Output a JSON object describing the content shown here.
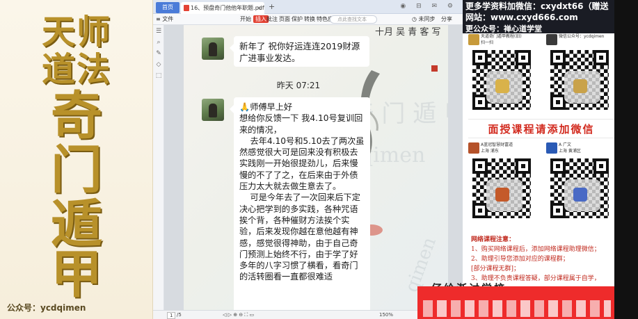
{
  "left_banner": {
    "line1": "天师",
    "line2": "道法",
    "vertical": [
      "奇",
      "门",
      "遁",
      "甲"
    ],
    "footer": "公众号：ycdqimen"
  },
  "app": {
    "tabs": {
      "home": "首页",
      "doc": "16、预盘奇门他他年职题.pdf *",
      "close": "×",
      "plus": "+"
    },
    "title_icons": "◉ ⊟ ✉ ⚙",
    "toolbar": {
      "file": "≡ 文件",
      "items": [
        "开始",
        "插入",
        "批注",
        "页面",
        "保护",
        "转换",
        "特色应用"
      ],
      "active": "插入",
      "search_placeholder": "点此查找文本",
      "sync": "◷ 未同步",
      "share": "分享"
    },
    "sidebar_icons": [
      "☰",
      "⌕",
      "✎",
      "◇",
      "⬚"
    ],
    "chat": {
      "bubble1": "新年了 祝你好运连连2019财源广进事业发达。",
      "timestamp": "昨天 07:21",
      "bubble2_icon": "🙏",
      "bubble2_head": "师傅早上好",
      "bubble2_body": "想给你反馈一下 我4.10号复训回来的情况，\n    去年4.10号和5.10去了两次虽然感觉很大可是回来没有积极去实践刚一开始很提劲儿，后来慢慢的不了了之，在后来由于外债压力太大就去做生意去了。\n    可是今年去了一次回来后下定决心把学到的多实践，各种咒语挨个背，各种催财方法挨个实验，后来发现你越在意他越有神感，感觉很得神助，由于自己奇门预测上始终不行，由于学了好多年的八字习惯了横看，看奇门的活转圈看一直都很难适"
    },
    "calligraphy": "十月 吴 青 客 写",
    "watermarks": [
      "天 道 奇 门 遁 甲",
      "ycdqimen",
      "qimen"
    ],
    "statusbar": {
      "page": "1",
      "total": "/5",
      "zoom": "150%",
      "icons": "◁ ▷ ⊕ ⊖ ⛶ ▭"
    }
  },
  "right_panel": {
    "line1": "更多学资料加微信：cxydxt66（赠送",
    "line2": "网站：www.cxyd666.com",
    "line3": "更公众号：禅心道学堂",
    "qr_cards": [
      {
        "title": "天道奇门遁甲教程(旧)",
        "sub": "扫一扫",
        "logo": "#c79a3a"
      },
      {
        "title": "微信公众号：ycdqimen",
        "sub": "",
        "logo": "#3a3a3a"
      },
      {
        "title": "A蓝冠智慧财富道",
        "sub": "上海 浦东",
        "logo": "#b5522a"
      },
      {
        "title": "A 广文",
        "sub": "上海 黄浦区",
        "logo": "#2a5ab5"
      }
    ],
    "banner": "面授课程请添加微信",
    "notes_title": "网络课程注意：",
    "notes": [
      "1、购买网络课程后，添加网络课程助理微信；",
      "2、助理引导您添加对应的课程群；",
      "   [部分课程无群]；",
      "3、助理不负责课程答疑，部分课程属于自学，"
    ],
    "partial": "仔给渐讨学校"
  }
}
